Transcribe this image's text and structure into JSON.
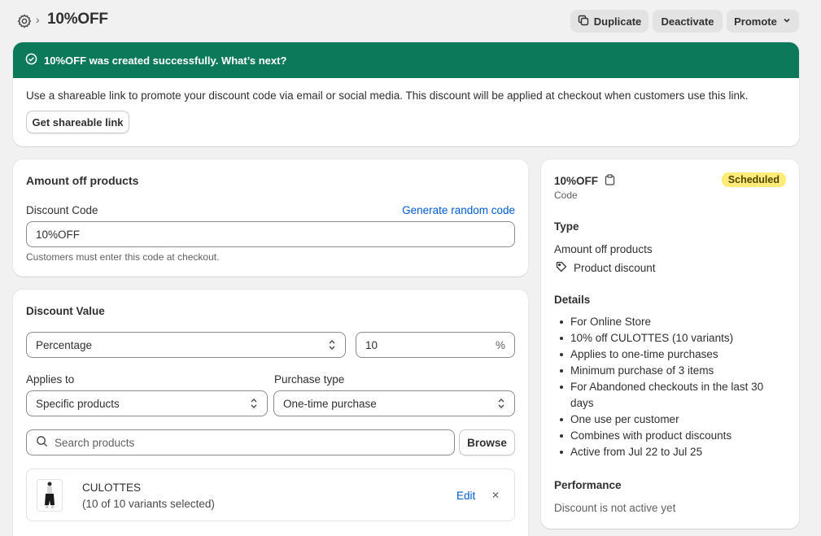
{
  "header": {
    "breadcrumb_sep": "›",
    "title": "10%OFF",
    "duplicate_label": "Duplicate",
    "deactivate_label": "Deactivate",
    "promote_label": "Promote"
  },
  "banner": {
    "title": "10%OFF was created successfully. What’s next?",
    "body": "Use a shareable link to promote your discount code via email or social media. This discount will be applied at checkout when customers use this link.",
    "button_label": "Get shareable link",
    "color": "#0c7a5a"
  },
  "amount_card": {
    "title": "Amount off products",
    "code_label": "Discount Code",
    "generate_link": "Generate random code",
    "code_value": "10%OFF",
    "help": "Customers must enter this code at checkout."
  },
  "value_card": {
    "title": "Discount Value",
    "type_value": "Percentage",
    "amount_value": "10",
    "amount_suffix": "%",
    "applies_label": "Applies to",
    "applies_value": "Specific products",
    "purchase_label": "Purchase type",
    "purchase_value": "One-time purchase",
    "search_placeholder": "Search products",
    "browse_label": "Browse",
    "product": {
      "name": "CULOTTES",
      "variants": "(10 of 10 variants selected)",
      "edit_label": "Edit",
      "remove_glyph": "✕"
    }
  },
  "summary": {
    "code": "10%OFF",
    "code_caption": "Code",
    "status": "Scheduled",
    "type_heading": "Type",
    "type_value": "Amount off products",
    "type_sub": "Product discount",
    "details_heading": "Details",
    "details": [
      "For Online Store",
      "10% off CULOTTES (10 variants)",
      "Applies to one-time purchases",
      "Minimum purchase of 3 items",
      "For Abandoned checkouts in the last 30 days",
      "One use per customer",
      "Combines with product discounts",
      "Active from Jul 22 to Jul 25"
    ],
    "performance_heading": "Performance",
    "performance_value": "Discount is not active yet"
  },
  "icons": {
    "breadcrumb": "gear-icon",
    "duplicate": "copy-icon",
    "promote": "chevron-down-icon",
    "banner": "check-circle-icon",
    "select": "select-arrows-icon",
    "search": "search-icon",
    "clipboard": "clipboard-icon",
    "tag": "tag-icon",
    "remove": "close-icon"
  }
}
